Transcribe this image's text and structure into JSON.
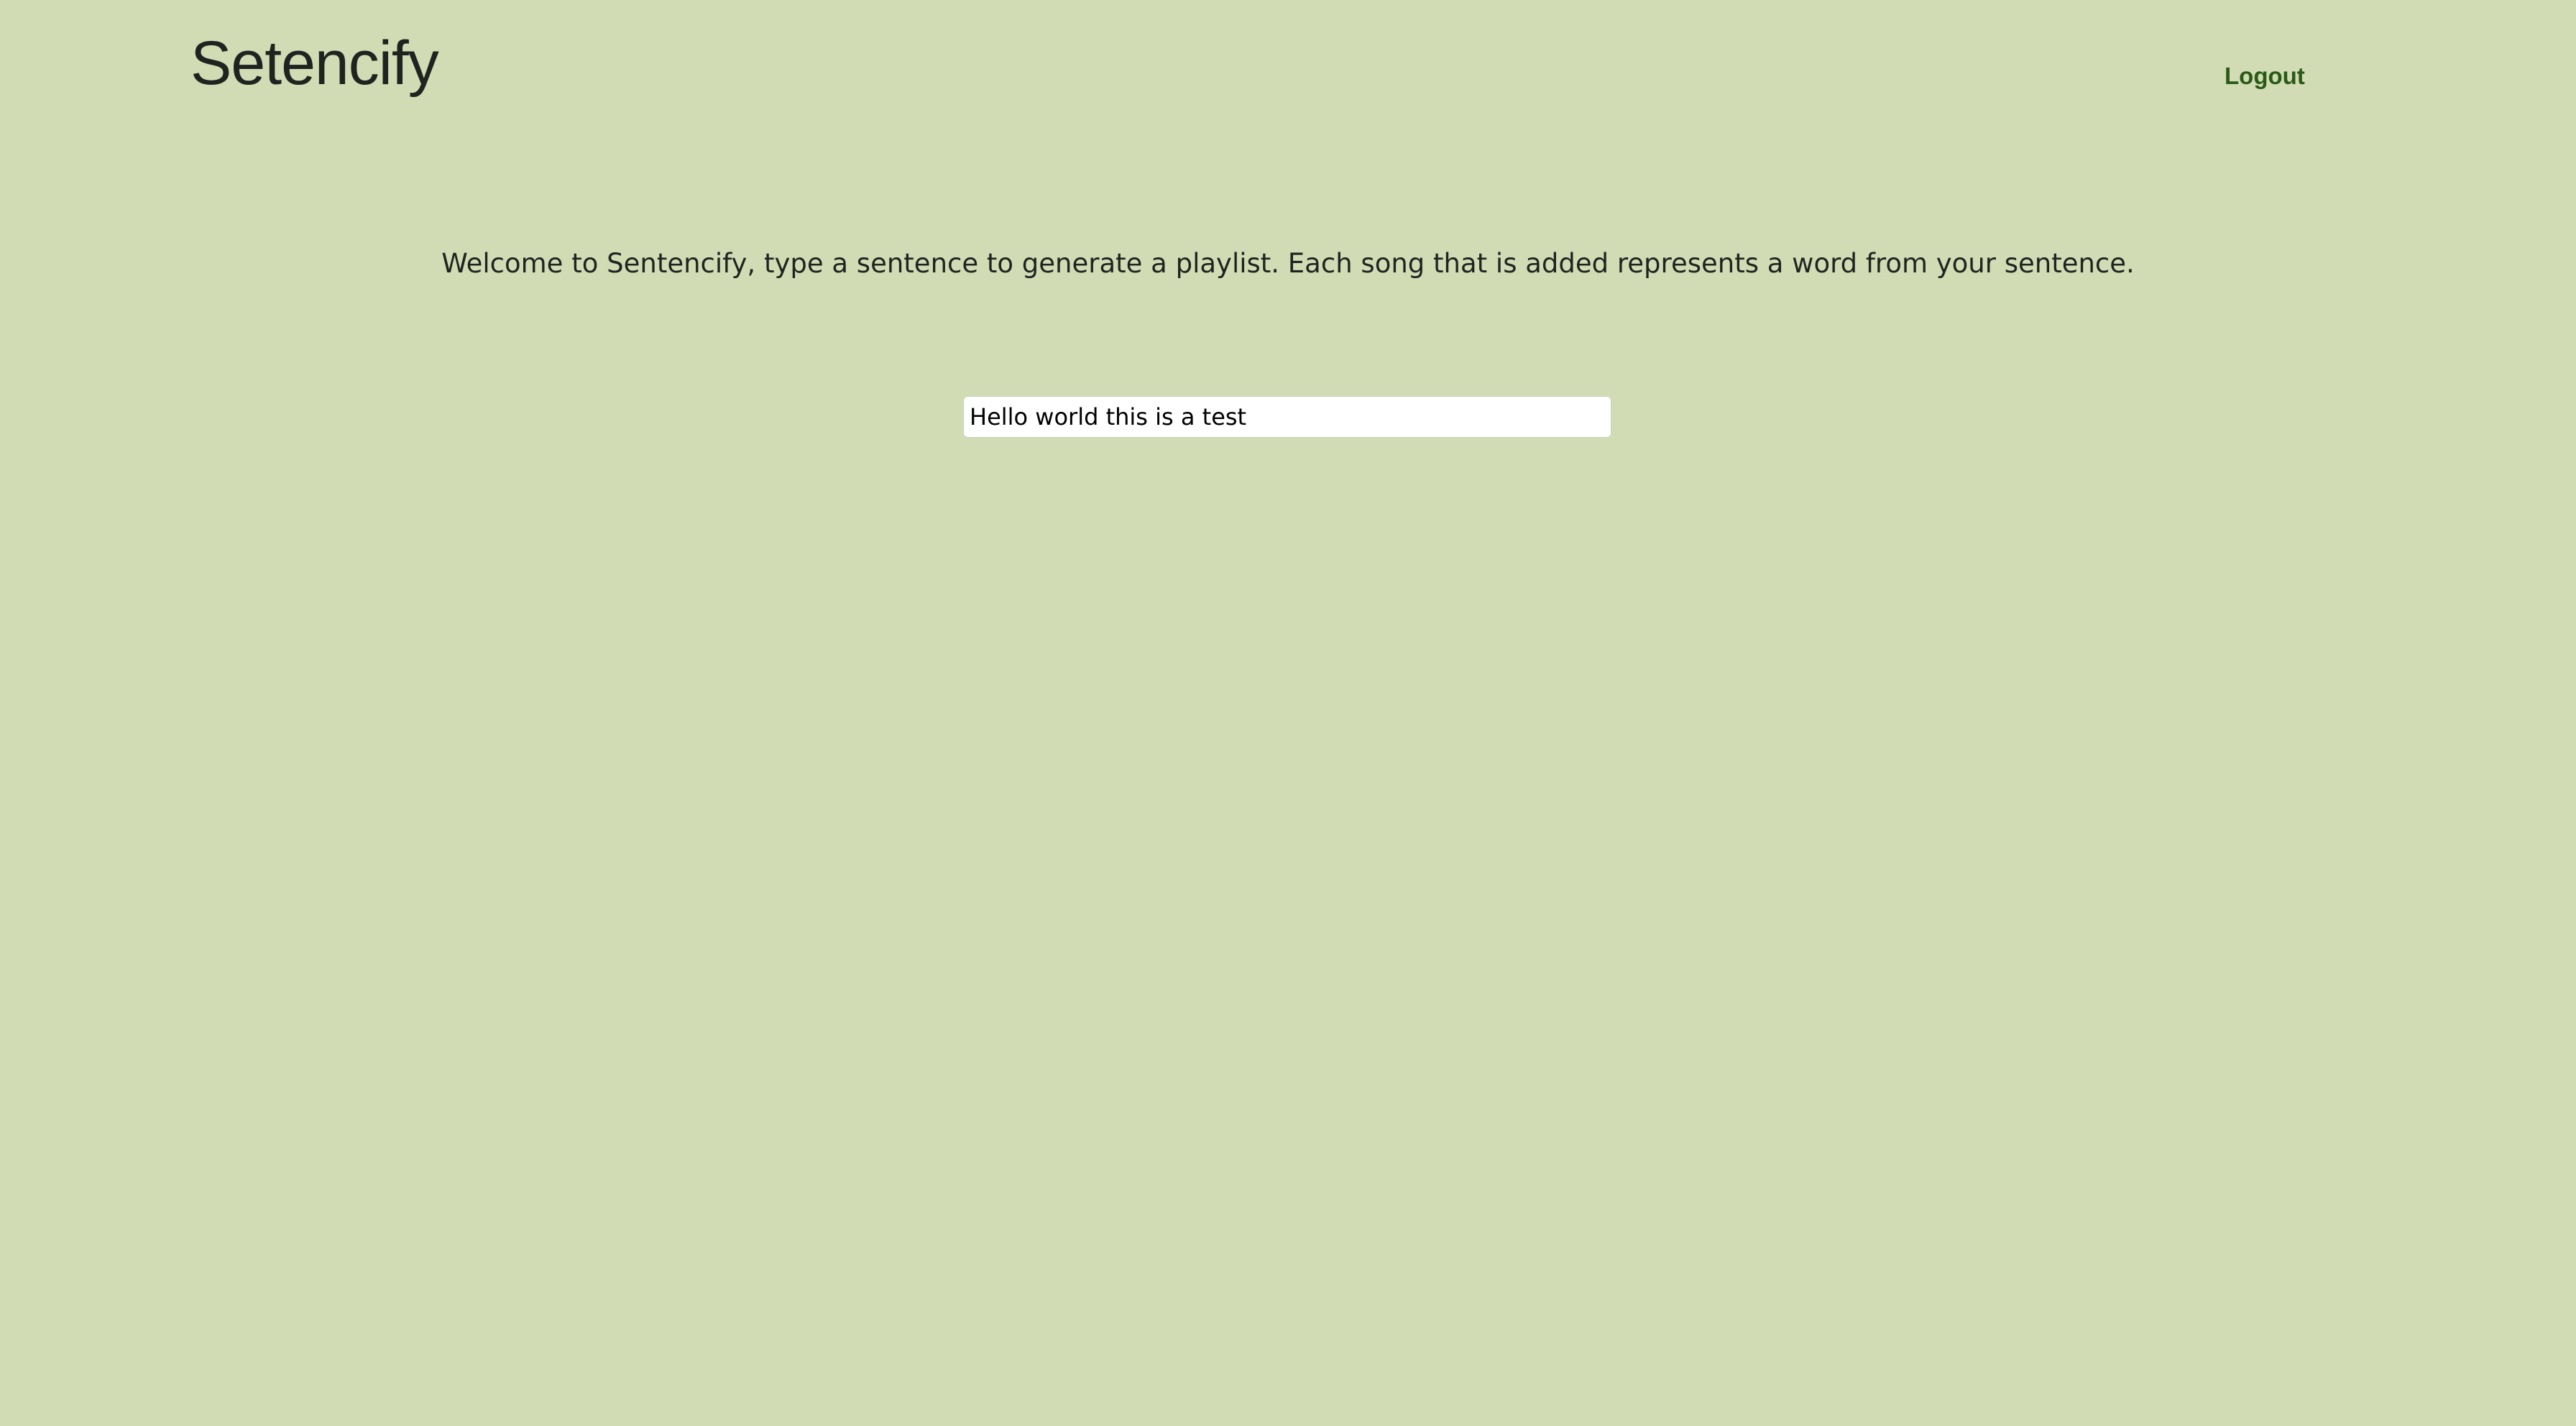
{
  "app": {
    "brand": "Setencify"
  },
  "header": {
    "logout_label": "Logout"
  },
  "main": {
    "welcome_text": "Welcome to Sentencify, type a sentence to generate a playlist. Each song that is added represents a word from your sentence.",
    "sentence_input": {
      "value": "Hello world this is a test"
    }
  },
  "colors": {
    "background": "#d1dcb5",
    "text": "#1f2420",
    "logout_link": "#2b5a17",
    "input_background": "#ffffff"
  }
}
